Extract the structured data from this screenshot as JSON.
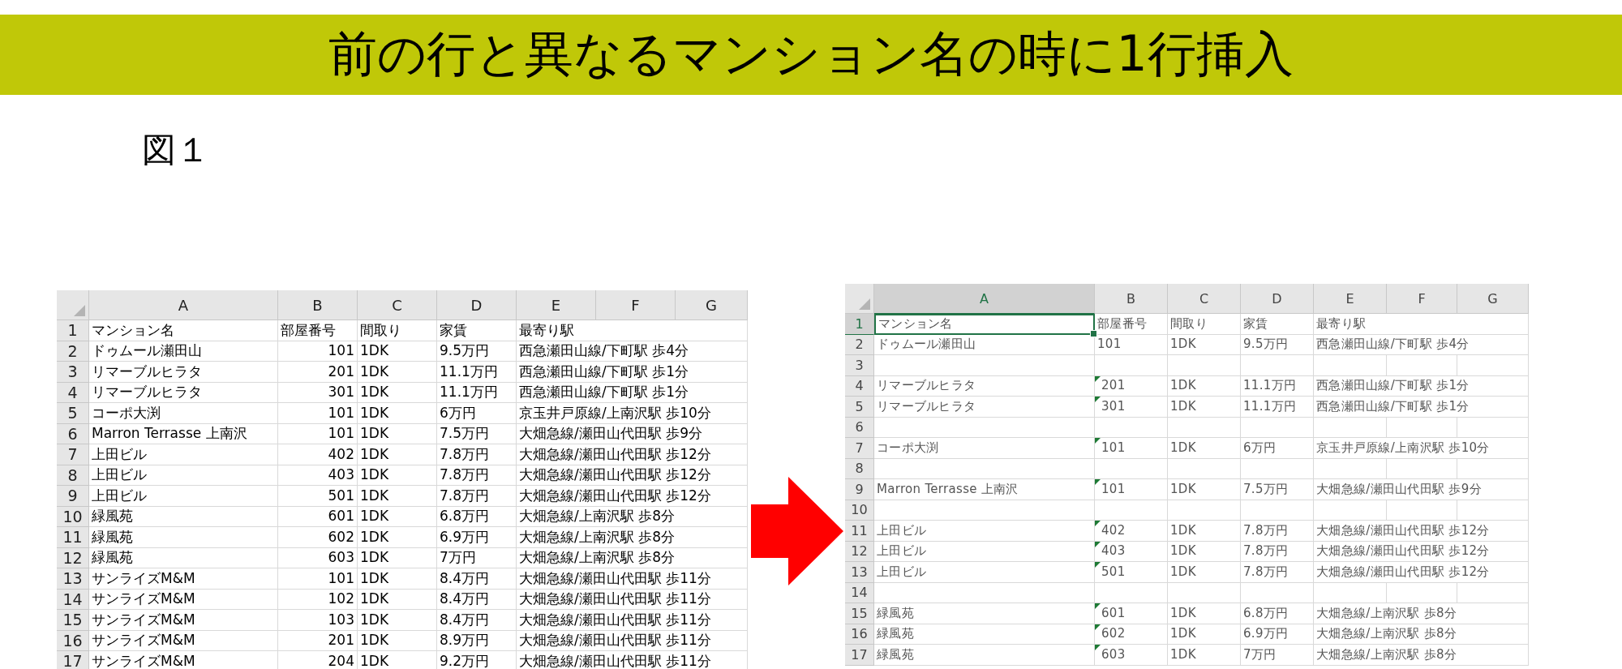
{
  "banner": {
    "title": "前の行と異なるマンション名の時に1行挿入"
  },
  "figure_label": "図１",
  "sheets": [
    {
      "columns": [
        {
          "label": "A",
          "selected": false
        },
        {
          "label": "B",
          "selected": false
        },
        {
          "label": "C",
          "selected": false
        },
        {
          "label": "D",
          "selected": false
        },
        {
          "label": "E",
          "selected": false
        },
        {
          "label": "F",
          "selected": false
        },
        {
          "label": "G",
          "selected": false
        }
      ],
      "rows": [
        {
          "number": "1",
          "kind": "header",
          "selected": false,
          "cells": [
            "マンション名",
            "部屋番号",
            "間取り",
            "家賃",
            "最寄り駅"
          ]
        },
        {
          "number": "2",
          "kind": "number",
          "selected": false,
          "cells": [
            "ドゥムール瀬田山",
            "101",
            "1DK",
            "9.5万円",
            "西急瀬田山線/下町駅 歩4分"
          ]
        },
        {
          "number": "3",
          "kind": "number",
          "selected": false,
          "cells": [
            "リマーブルヒラタ",
            "201",
            "1DK",
            "11.1万円",
            "西急瀬田山線/下町駅 歩1分"
          ]
        },
        {
          "number": "4",
          "kind": "number",
          "selected": false,
          "cells": [
            "リマーブルヒラタ",
            "301",
            "1DK",
            "11.1万円",
            "西急瀬田山線/下町駅 歩1分"
          ]
        },
        {
          "number": "5",
          "kind": "number",
          "selected": false,
          "cells": [
            "コーポ大渕",
            "101",
            "1DK",
            "6万円",
            "京玉井戸原線/上南沢駅 歩10分"
          ]
        },
        {
          "number": "6",
          "kind": "number",
          "selected": false,
          "cells": [
            "Marron Terrasse 上南沢",
            "101",
            "1DK",
            "7.5万円",
            "大畑急線/瀬田山代田駅 歩9分"
          ]
        },
        {
          "number": "7",
          "kind": "number",
          "selected": false,
          "cells": [
            "上田ビル",
            "402",
            "1DK",
            "7.8万円",
            "大畑急線/瀬田山代田駅 歩12分"
          ]
        },
        {
          "number": "8",
          "kind": "number",
          "selected": false,
          "cells": [
            "上田ビル",
            "403",
            "1DK",
            "7.8万円",
            "大畑急線/瀬田山代田駅 歩12分"
          ]
        },
        {
          "number": "9",
          "kind": "number",
          "selected": false,
          "cells": [
            "上田ビル",
            "501",
            "1DK",
            "7.8万円",
            "大畑急線/瀬田山代田駅 歩12分"
          ]
        },
        {
          "number": "10",
          "kind": "number",
          "selected": false,
          "cells": [
            "緑風苑",
            "601",
            "1DK",
            "6.8万円",
            "大畑急線/上南沢駅 歩8分"
          ]
        },
        {
          "number": "11",
          "kind": "number",
          "selected": false,
          "cells": [
            "緑風苑",
            "602",
            "1DK",
            "6.9万円",
            "大畑急線/上南沢駅 歩8分"
          ]
        },
        {
          "number": "12",
          "kind": "number",
          "selected": false,
          "cells": [
            "緑風苑",
            "603",
            "1DK",
            "7万円",
            "大畑急線/上南沢駅 歩8分"
          ]
        },
        {
          "number": "13",
          "kind": "number",
          "selected": false,
          "cells": [
            "サンライズM&M",
            "101",
            "1DK",
            "8.4万円",
            "大畑急線/瀬田山代田駅 歩11分"
          ]
        },
        {
          "number": "14",
          "kind": "number",
          "selected": false,
          "cells": [
            "サンライズM&M",
            "102",
            "1DK",
            "8.4万円",
            "大畑急線/瀬田山代田駅 歩11分"
          ]
        },
        {
          "number": "15",
          "kind": "number",
          "selected": false,
          "cells": [
            "サンライズM&M",
            "103",
            "1DK",
            "8.4万円",
            "大畑急線/瀬田山代田駅 歩11分"
          ]
        },
        {
          "number": "16",
          "kind": "number",
          "selected": false,
          "cells": [
            "サンライズM&M",
            "201",
            "1DK",
            "8.9万円",
            "大畑急線/瀬田山代田駅 歩11分"
          ]
        },
        {
          "number": "17",
          "kind": "number",
          "selected": false,
          "cells": [
            "サンライズM&M",
            "204",
            "1DK",
            "9.2万円",
            "大畑急線/瀬田山代田駅 歩11分"
          ]
        }
      ]
    },
    {
      "columns": [
        {
          "label": "A",
          "selected": true
        },
        {
          "label": "B",
          "selected": false
        },
        {
          "label": "C",
          "selected": false
        },
        {
          "label": "D",
          "selected": false
        },
        {
          "label": "E",
          "selected": false
        },
        {
          "label": "F",
          "selected": false
        },
        {
          "label": "G",
          "selected": false
        }
      ],
      "rows": [
        {
          "number": "1",
          "kind": "header",
          "selected": true,
          "flagged": false,
          "cells": [
            "マンション名",
            "部屋番号",
            "間取り",
            "家賃",
            "最寄り駅"
          ]
        },
        {
          "number": "2",
          "kind": "text",
          "selected": false,
          "flagged": false,
          "cells": [
            "ドゥムール瀬田山",
            "101",
            "1DK",
            "9.5万円",
            "西急瀬田山線/下町駅 歩4分"
          ]
        },
        {
          "number": "3",
          "kind": "blank",
          "selected": false,
          "flagged": false
        },
        {
          "number": "4",
          "kind": "text",
          "selected": false,
          "flagged": true,
          "cells": [
            "リマーブルヒラタ",
            "201",
            "1DK",
            "11.1万円",
            "西急瀬田山線/下町駅 歩1分"
          ]
        },
        {
          "number": "5",
          "kind": "text",
          "selected": false,
          "flagged": true,
          "cells": [
            "リマーブルヒラタ",
            "301",
            "1DK",
            "11.1万円",
            "西急瀬田山線/下町駅 歩1分"
          ]
        },
        {
          "number": "6",
          "kind": "blank",
          "selected": false,
          "flagged": false
        },
        {
          "number": "7",
          "kind": "text",
          "selected": false,
          "flagged": true,
          "cells": [
            "コーポ大渕",
            "101",
            "1DK",
            "6万円",
            "京玉井戸原線/上南沢駅 歩10分"
          ]
        },
        {
          "number": "8",
          "kind": "blank",
          "selected": false,
          "flagged": false
        },
        {
          "number": "9",
          "kind": "text",
          "selected": false,
          "flagged": true,
          "cells": [
            "Marron Terrasse 上南沢",
            "101",
            "1DK",
            "7.5万円",
            "大畑急線/瀬田山代田駅 歩9分"
          ]
        },
        {
          "number": "10",
          "kind": "blank",
          "selected": false,
          "flagged": false
        },
        {
          "number": "11",
          "kind": "text",
          "selected": false,
          "flagged": true,
          "cells": [
            "上田ビル",
            "402",
            "1DK",
            "7.8万円",
            "大畑急線/瀬田山代田駅 歩12分"
          ]
        },
        {
          "number": "12",
          "kind": "text",
          "selected": false,
          "flagged": true,
          "cells": [
            "上田ビル",
            "403",
            "1DK",
            "7.8万円",
            "大畑急線/瀬田山代田駅 歩12分"
          ]
        },
        {
          "number": "13",
          "kind": "text",
          "selected": false,
          "flagged": true,
          "cells": [
            "上田ビル",
            "501",
            "1DK",
            "7.8万円",
            "大畑急線/瀬田山代田駅 歩12分"
          ]
        },
        {
          "number": "14",
          "kind": "blank",
          "selected": false,
          "flagged": false
        },
        {
          "number": "15",
          "kind": "text",
          "selected": false,
          "flagged": true,
          "cells": [
            "緑風苑",
            "601",
            "1DK",
            "6.8万円",
            "大畑急線/上南沢駅 歩8分"
          ]
        },
        {
          "number": "16",
          "kind": "text",
          "selected": false,
          "flagged": true,
          "cells": [
            "緑風苑",
            "602",
            "1DK",
            "6.9万円",
            "大畑急線/上南沢駅 歩8分"
          ]
        },
        {
          "number": "17",
          "kind": "text",
          "selected": false,
          "flagged": true,
          "cells": [
            "緑風苑",
            "603",
            "1DK",
            "7万円",
            "大畑急線/上南沢駅 歩8分"
          ]
        }
      ]
    }
  ]
}
